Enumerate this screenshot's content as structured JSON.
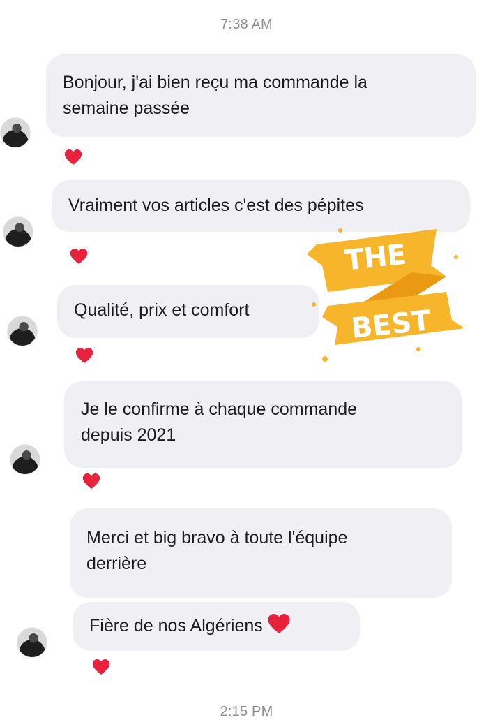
{
  "timestamps": {
    "top": "7:38 AM",
    "bottom": "2:15 PM"
  },
  "messages": [
    {
      "lines": [
        "Bonjour, j'ai bien reçu ma commande la",
        "semaine passée"
      ],
      "reaction": "heart"
    },
    {
      "lines": [
        "Vraiment vos articles c'est des pépites"
      ],
      "reaction": "heart"
    },
    {
      "lines": [
        "Qualité, prix et comfort"
      ],
      "reaction": "heart"
    },
    {
      "lines": [
        "Je le confirme à chaque commande",
        "depuis 2021"
      ],
      "reaction": "heart"
    },
    {
      "lines": [
        "Merci et big bravo à toute l'équipe",
        "derrière"
      ]
    },
    {
      "lines": [
        "Fière de nos Algériens"
      ],
      "inline_emoji": "red-heart",
      "reaction": "heart"
    }
  ],
  "sticker": {
    "top_text": "THE",
    "bottom_text": "BEST"
  },
  "colors": {
    "bubble": "#efeff4",
    "heart": "#e8213d",
    "sticker": "#f7b52c"
  }
}
